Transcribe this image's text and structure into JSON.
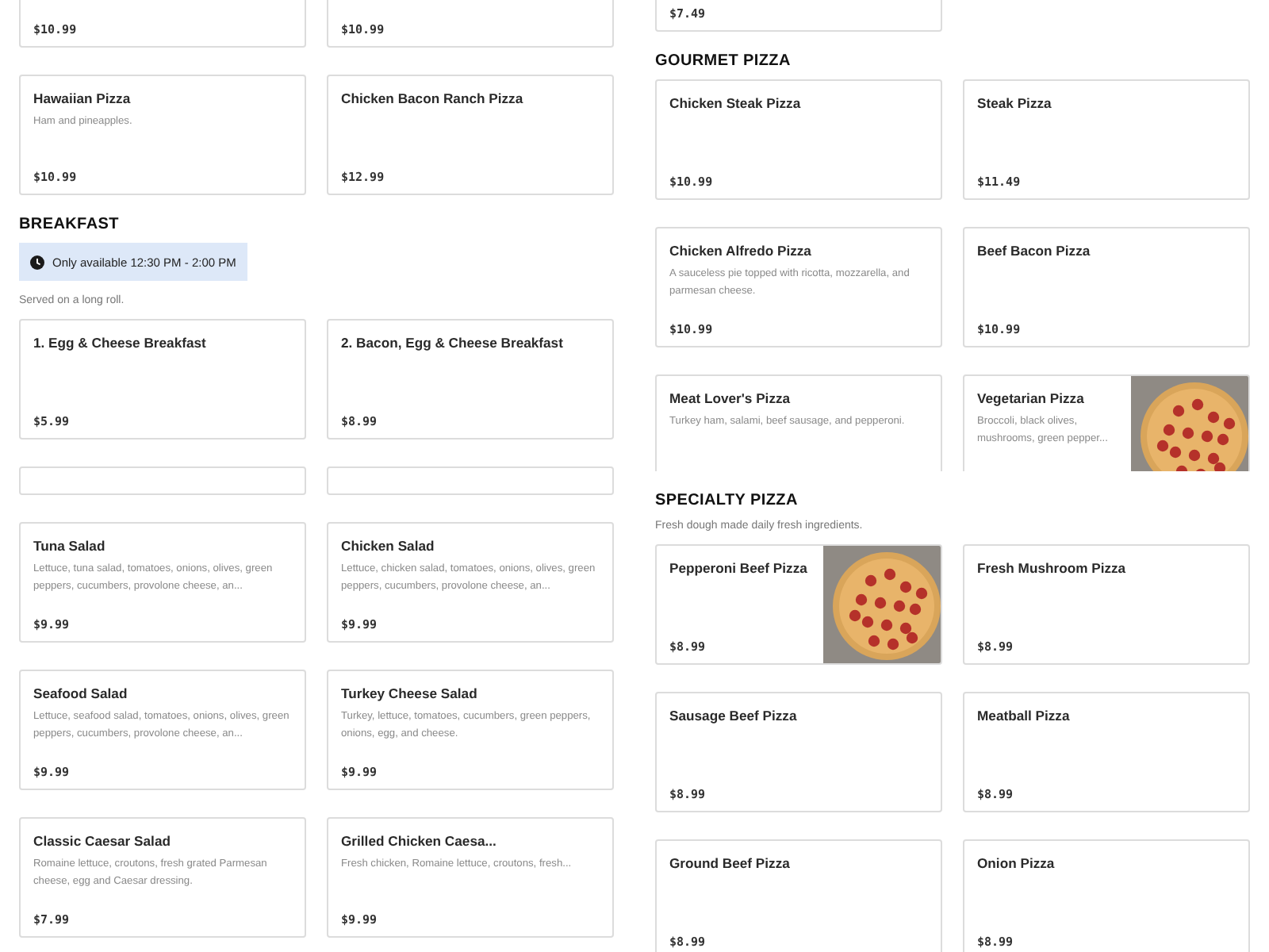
{
  "columns": [
    {
      "blocks": [
        {
          "kind": "cards",
          "items": [
            {
              "price": "$10.99"
            },
            {
              "price": "$10.99"
            }
          ]
        },
        {
          "kind": "cards",
          "items": [
            {
              "name": "Hawaiian Pizza",
              "description": "Ham and pineapples.",
              "price": "$10.99"
            },
            {
              "name": "Chicken Bacon Ranch Pizza",
              "price": "$12.99"
            }
          ]
        },
        {
          "kind": "heading",
          "title": "BREAKFAST"
        },
        {
          "kind": "notice",
          "text": "Only available 12:30 PM - 2:00 PM"
        },
        {
          "kind": "note",
          "text": "Served on a long roll."
        },
        {
          "kind": "cards",
          "items": [
            {
              "name": "1. Egg & Cheese Breakfast",
              "price": "$5.99"
            },
            {
              "name": "2. Bacon, Egg & Cheese Breakfast",
              "price": "$8.99"
            }
          ]
        },
        {
          "kind": "blank_cards"
        },
        {
          "kind": "cards",
          "items": [
            {
              "name": "Tuna Salad",
              "description": "Lettuce, tuna salad, tomatoes, onions, olives, green peppers, cucumbers, provolone cheese, an...",
              "price": "$9.99"
            },
            {
              "name": "Chicken Salad",
              "description": "Lettuce, chicken salad, tomatoes, onions, olives, green peppers, cucumbers, provolone cheese, an...",
              "price": "$9.99"
            }
          ]
        },
        {
          "kind": "cards",
          "items": [
            {
              "name": "Seafood Salad",
              "description": "Lettuce, seafood salad, tomatoes, onions, olives, green peppers, cucumbers, provolone cheese, an...",
              "price": "$9.99"
            },
            {
              "name": "Turkey Cheese Salad",
              "description": "Turkey, lettuce, tomatoes, cucumbers, green peppers, onions, egg, and cheese.",
              "price": "$9.99"
            }
          ]
        },
        {
          "kind": "cards",
          "items": [
            {
              "name": "Classic Caesar Salad",
              "description": "Romaine lettuce, croutons, fresh grated Parmesan cheese, egg and Caesar dressing.",
              "price": "$7.99"
            },
            {
              "name": "Grilled Chicken Caesa...",
              "description": "Fresh chicken, Romaine lettuce, croutons, fresh...",
              "price": "$9.99"
            }
          ]
        }
      ]
    },
    {
      "blocks": [
        {
          "kind": "cards",
          "items": [
            {
              "price": "$7.49"
            }
          ]
        },
        {
          "kind": "heading",
          "title": "GOURMET PIZZA"
        },
        {
          "kind": "cards",
          "items": [
            {
              "name": "Chicken Steak Pizza",
              "price": "$10.99"
            },
            {
              "name": "Steak Pizza",
              "price": "$11.49"
            }
          ]
        },
        {
          "kind": "cards",
          "items": [
            {
              "name": "Chicken Alfredo Pizza",
              "description": "A sauceless pie topped with ricotta, mozzarella, and parmesan cheese.",
              "price": "$10.99"
            },
            {
              "name": "Beef Bacon Pizza",
              "price": "$10.99"
            }
          ]
        },
        {
          "kind": "cards",
          "clipped": true,
          "items": [
            {
              "name": "Meat Lover's Pizza",
              "description": "Turkey ham, salami, beef sausage, and pepperoni."
            },
            {
              "name": "Vegetarian Pizza",
              "description": "Broccoli, black olives, mushrooms, green pepper...",
              "photo": true
            }
          ]
        },
        {
          "kind": "heading",
          "title": "SPECIALTY PIZZA"
        },
        {
          "kind": "note",
          "text": "Fresh dough made daily fresh ingredients."
        },
        {
          "kind": "cards",
          "items": [
            {
              "name": "Pepperoni Beef Pizza",
              "price": "$8.99",
              "photo": true
            },
            {
              "name": "Fresh Mushroom Pizza",
              "price": "$8.99"
            }
          ]
        },
        {
          "kind": "cards",
          "items": [
            {
              "name": "Sausage Beef Pizza",
              "price": "$8.99"
            },
            {
              "name": "Meatball Pizza",
              "price": "$8.99"
            }
          ]
        },
        {
          "kind": "cards",
          "items": [
            {
              "name": "Ground Beef Pizza",
              "price": "$8.99"
            },
            {
              "name": "Onion Pizza",
              "price": "$8.99"
            }
          ]
        }
      ]
    }
  ]
}
